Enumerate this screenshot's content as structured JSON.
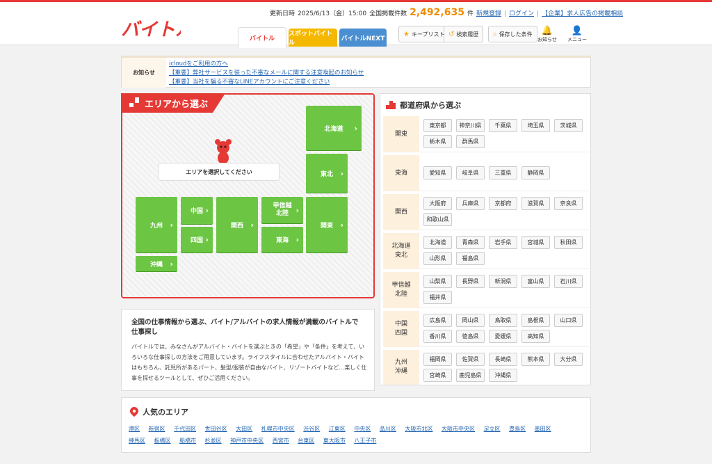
{
  "header": {
    "logo_alt": "バイトル",
    "updated_label": "更新日時",
    "updated_value": "2025/6/13（金）15:00",
    "count_label": "全国掲載件数",
    "count_value": "2,492,635",
    "count_unit": "件",
    "register_link": "新規登録",
    "login_link": "ログイン",
    "corp_link": "【企業】求人広告の掲載相談",
    "tabs": [
      "バイトル",
      "スポットバイトル",
      "バイトルNEXT"
    ],
    "keeplist": "キープリスト",
    "history": "検索履歴",
    "saved": "保存した条件",
    "notice_icon_label": "お知らせ",
    "menu_label": "メニュー"
  },
  "notice": {
    "label": "お知らせ",
    "items": [
      "icloudをご利用の方へ",
      "【重要】弊社サービスを装った不審なメールに関する注意喚起のお知らせ",
      "【重要】当社を騙る不審なLINEアカウントにご注意ください"
    ]
  },
  "area": {
    "title": "エリアから選ぶ",
    "prompt": "エリアを選択してください",
    "regions": {
      "hokkaido": "北海道",
      "tohoku": "東北",
      "koshinetsu": "甲信越\n北陸",
      "kanto": "関東",
      "kansai": "関西",
      "tokai": "東海",
      "chugoku": "中国",
      "shikoku": "四国",
      "kyushu": "九州",
      "okinawa": "沖縄"
    }
  },
  "info": {
    "title": "全国の仕事情報から選ぶ、バイト/アルバイトの求人情報が満載のバイトルで仕事探し",
    "body": "バイトルでは、みなさんがアルバイト・バイトを選ぶときの「希望」や「条件」を考えて、いろいろな仕事探しの方法をご用意しています。ライフスタイルに合わせたアルバイト・バイトはもちろん、託児所があるパート、髪型/服装が自由なバイト、リゾートバイトなど…楽しく仕事を探せるツールとして、ぜひご活用ください。"
  },
  "prefectures": {
    "title": "都道府県から選ぶ",
    "rows": [
      {
        "label": "関東",
        "items": [
          "東京都",
          "神奈川県",
          "千葉県",
          "埼玉県",
          "茨城県",
          "栃木県",
          "群馬県"
        ]
      },
      {
        "label": "東海",
        "items": [
          "愛知県",
          "岐阜県",
          "三重県",
          "静岡県"
        ]
      },
      {
        "label": "関西",
        "items": [
          "大阪府",
          "兵庫県",
          "京都府",
          "滋賀県",
          "奈良県",
          "和歌山県"
        ]
      },
      {
        "label": "北海道\n東北",
        "items": [
          "北海道",
          "青森県",
          "岩手県",
          "宮城県",
          "秋田県",
          "山形県",
          "福島県"
        ]
      },
      {
        "label": "甲信越\n北陸",
        "items": [
          "山梨県",
          "長野県",
          "新潟県",
          "富山県",
          "石川県",
          "福井県"
        ]
      },
      {
        "label": "中国\n四国",
        "items": [
          "広島県",
          "岡山県",
          "鳥取県",
          "島根県",
          "山口県",
          "香川県",
          "徳島県",
          "愛媛県",
          "高知県"
        ]
      },
      {
        "label": "九州\n沖縄",
        "items": [
          "福岡県",
          "佐賀県",
          "長崎県",
          "熊本県",
          "大分県",
          "宮崎県",
          "鹿児島県",
          "沖縄県"
        ]
      }
    ]
  },
  "popular": {
    "title": "人気のエリア",
    "links": [
      "港区",
      "新宿区",
      "千代田区",
      "世田谷区",
      "大田区",
      "札幌市中央区",
      "渋谷区",
      "江東区",
      "中央区",
      "品川区",
      "大阪市北区",
      "大阪市中央区",
      "足立区",
      "豊島区",
      "墨田区",
      "練馬区",
      "板橋区",
      "船橋市",
      "杉並区",
      "神戸市中央区",
      "西宮市",
      "台東区",
      "東大阪市",
      "八王子市"
    ]
  },
  "colors": {
    "brand_red": "#e53935",
    "region_green": "#6cc644",
    "spot_yellow": "#f5b800",
    "next_blue": "#4a8fd1",
    "count_orange": "#f08c00"
  }
}
